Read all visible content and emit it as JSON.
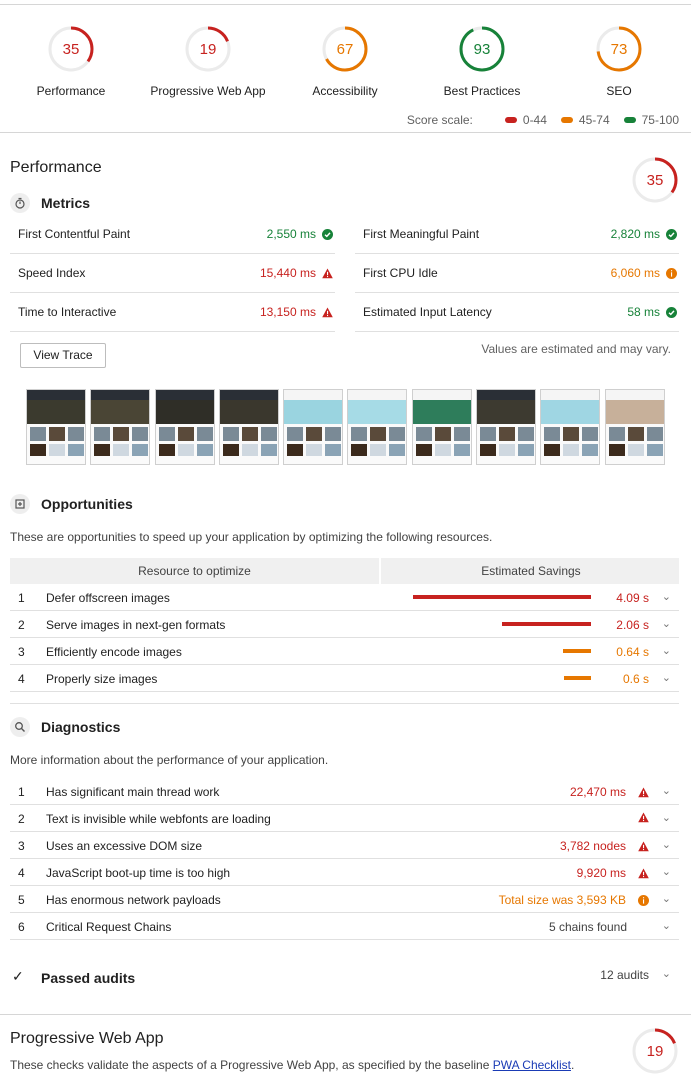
{
  "categories": [
    {
      "score": "35",
      "label": "Performance",
      "value": 35,
      "color": "#c7221f"
    },
    {
      "score": "19",
      "label": "Progressive Web App",
      "value": 19,
      "color": "#c7221f"
    },
    {
      "score": "67",
      "label": "Accessibility",
      "value": 67,
      "color": "#e67700"
    },
    {
      "score": "93",
      "label": "Best Practices",
      "value": 93,
      "color": "#178239"
    },
    {
      "score": "73",
      "label": "SEO",
      "value": 73,
      "color": "#e67700"
    }
  ],
  "scale": {
    "label": "Score scale:",
    "items": [
      {
        "range": "0-44",
        "color": "#c7221f"
      },
      {
        "range": "45-74",
        "color": "#e67700"
      },
      {
        "range": "75-100",
        "color": "#178239"
      }
    ]
  },
  "performance": {
    "title": "Performance",
    "score": "35",
    "metrics_title": "Metrics",
    "metrics": [
      {
        "title": "First Contentful Paint",
        "value": "2,550 ms",
        "status": "pass"
      },
      {
        "title": "First Meaningful Paint",
        "value": "2,820 ms",
        "status": "pass"
      },
      {
        "title": "Speed Index",
        "value": "15,440 ms",
        "status": "fail"
      },
      {
        "title": "First CPU Idle",
        "value": "6,060 ms",
        "status": "average"
      },
      {
        "title": "Time to Interactive",
        "value": "13,150 ms",
        "status": "fail"
      },
      {
        "title": "Estimated Input Latency",
        "value": "58 ms",
        "status": "pass"
      }
    ],
    "view_trace": "View Trace",
    "estimate_note": "Values are estimated and may vary.",
    "opportunities_title": "Opportunities",
    "opportunities_desc": "These are opportunities to speed up your application by optimizing the following resources.",
    "table_headers": [
      "Resource to optimize",
      "Estimated Savings"
    ],
    "opportunities": [
      {
        "index": "1",
        "title": "Defer offscreen images",
        "savings": "4.09 s",
        "fraction": 1.0,
        "color": "#c7221f"
      },
      {
        "index": "2",
        "title": "Serve images in next-gen formats",
        "savings": "2.06 s",
        "fraction": 0.5,
        "color": "#c7221f"
      },
      {
        "index": "3",
        "title": "Efficiently encode images",
        "savings": "0.64 s",
        "fraction": 0.16,
        "color": "#e67700"
      },
      {
        "index": "4",
        "title": "Properly size images",
        "savings": "0.6 s",
        "fraction": 0.15,
        "color": "#e67700"
      }
    ],
    "diagnostics_title": "Diagnostics",
    "diagnostics_desc": "More information about the performance of your application.",
    "diagnostics": [
      {
        "index": "1",
        "title": "Has significant main thread work",
        "value": "22,470 ms",
        "status": "fail"
      },
      {
        "index": "2",
        "title": "Text is invisible while webfonts are loading",
        "value": "",
        "status": "fail"
      },
      {
        "index": "3",
        "title": "Uses an excessive DOM size",
        "value": "3,782 nodes",
        "status": "fail"
      },
      {
        "index": "4",
        "title": "JavaScript boot-up time is too high",
        "value": "9,920 ms",
        "status": "fail"
      },
      {
        "index": "5",
        "title": "Has enormous network payloads",
        "value": "Total size was 3,593 KB",
        "status": "average"
      },
      {
        "index": "6",
        "title": "Critical Request Chains",
        "value": "5 chains found",
        "status": "info"
      }
    ],
    "passed_title": "Passed audits",
    "passed_count": "12 audits"
  },
  "pwa": {
    "title": "Progressive Web App",
    "score": "19",
    "desc_pre": "These checks validate the aspects of a Progressive Web App, as specified by the baseline ",
    "link": "PWA Checklist",
    "desc_post": "."
  }
}
